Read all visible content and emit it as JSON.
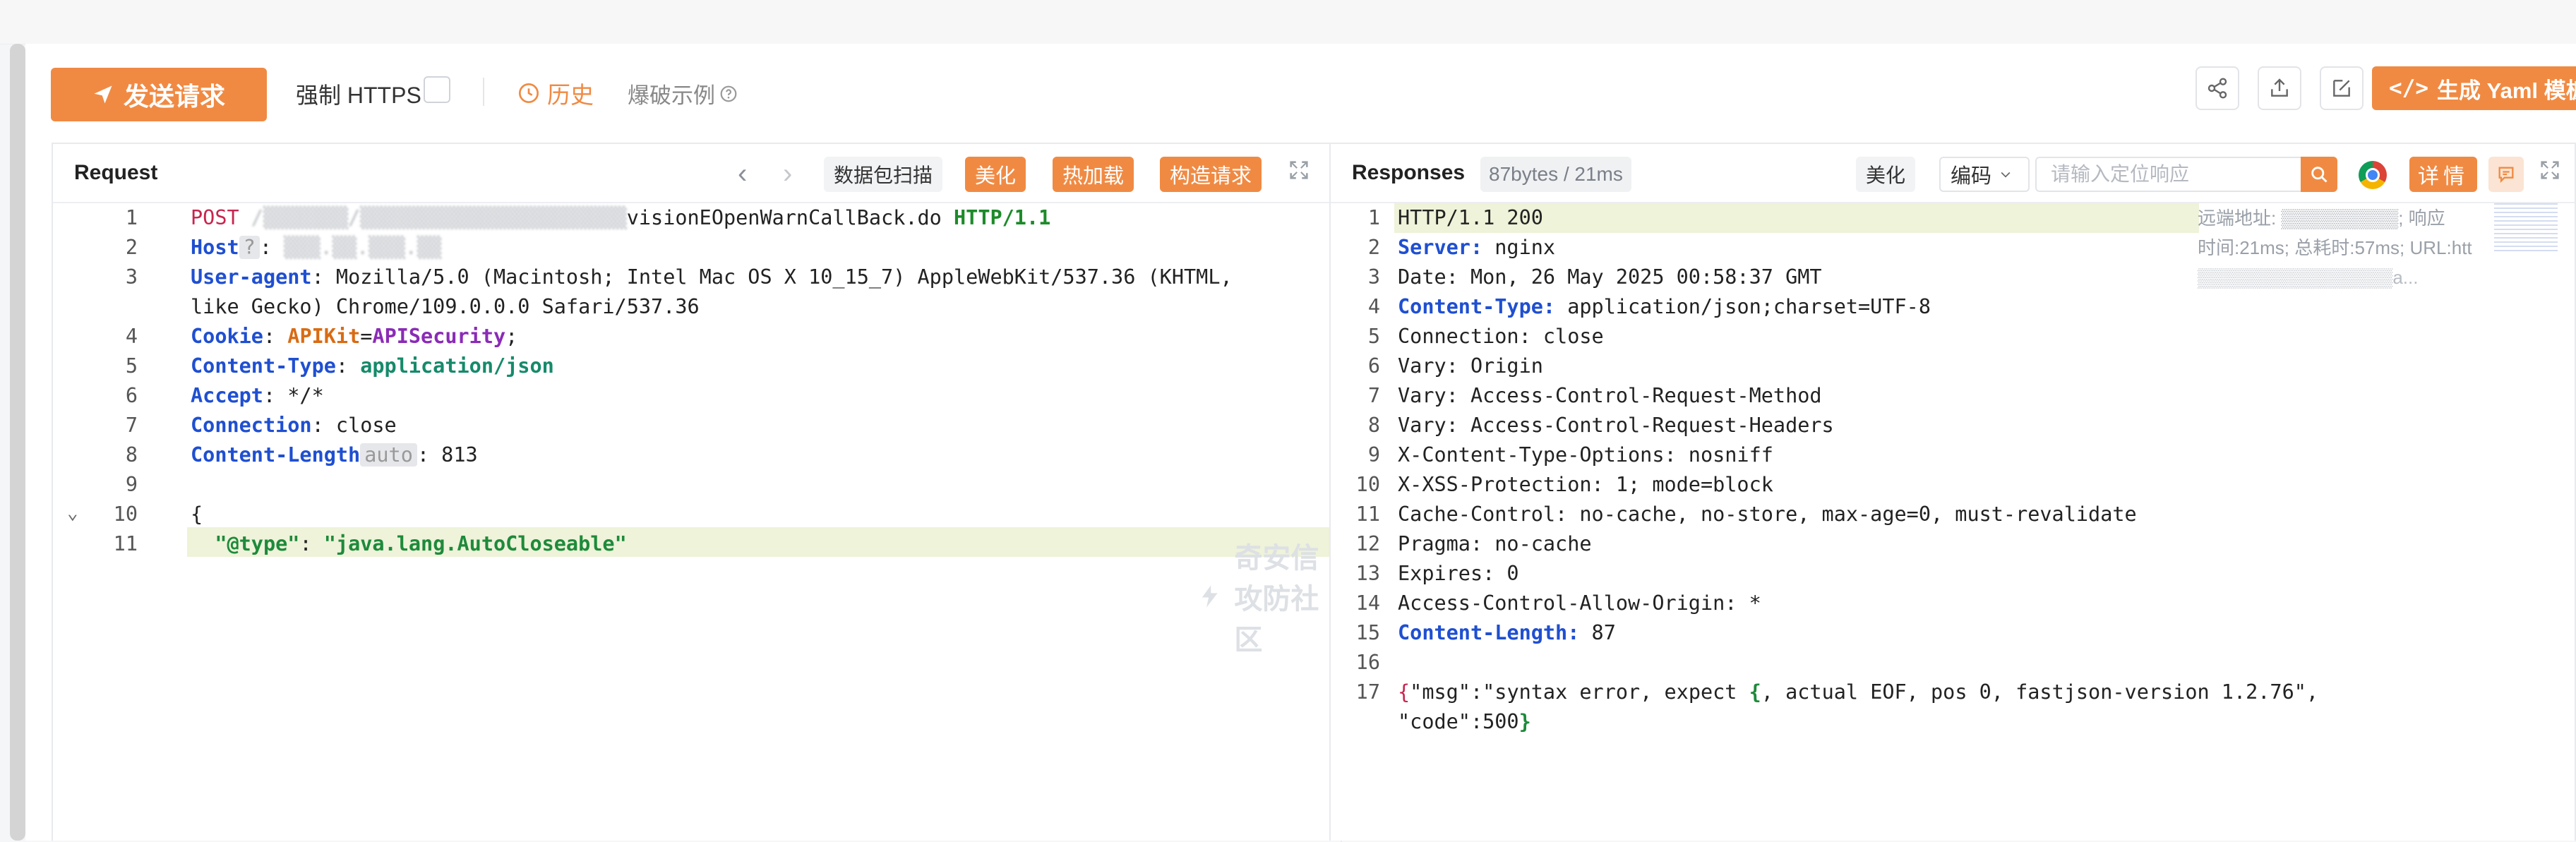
{
  "toolbar": {
    "send_label": "发送请求",
    "force_https_label": "强制 HTTPS",
    "history_label": "历史",
    "example_label": "爆破示例",
    "yaml_label": "生成 Yaml 模板"
  },
  "request": {
    "title": "Request",
    "scan_label": "数据包扫描",
    "beautify_label": "美化",
    "hotload_label": "热加载",
    "build_label": "构造请求"
  },
  "response": {
    "title": "Responses",
    "size_badge": "87bytes / 21ms",
    "beautify_label": "美化",
    "encode_label": "编码",
    "locate_placeholder": "请输入定位响应",
    "detail_label": "详情",
    "floating_info": [
      "远端地址: ▒▒▒▒▒▒▒▒▒; 响应",
      "时间:21ms; 总耗时:57ms; URL:htt",
      "▒▒▒▒▒▒▒▒▒▒▒▒▒▒▒a..."
    ]
  },
  "watermark": "奇安信攻防社区",
  "request_lines": [
    {
      "n": "1",
      "parts": [
        {
          "c": "k-red",
          "t": "POST "
        },
        {
          "c": "blur",
          "t": "/▒▒▒▒▒▒▒/▒▒▒▒▒▒▒▒▒▒▒▒▒▒▒▒▒▒▒▒▒▒"
        },
        {
          "c": "k-dark",
          "t": "visionEOpenWarnCallBack.do "
        },
        {
          "c": "k-green",
          "t": "HTTP/1.1"
        }
      ]
    },
    {
      "n": "2",
      "parts": [
        {
          "c": "k-blue",
          "t": "Host"
        },
        {
          "c": "chip",
          "t": "?"
        },
        {
          "c": "k-dark",
          "t": ": "
        },
        {
          "c": "blur",
          "t": "▒▒▒.▒▒.▒▒▒.▒▒"
        }
      ]
    },
    {
      "n": "3",
      "parts": [
        {
          "c": "k-blue",
          "t": "User-agent"
        },
        {
          "c": "k-dark",
          "t": ": Mozilla/5.0 (Macintosh; Intel Mac OS X 10_15_7) AppleWebKit/537.36 (KHTML,"
        }
      ]
    },
    {
      "n": "",
      "parts": [
        {
          "c": "k-dark",
          "t": "like Gecko) Chrome/109.0.0.0 Safari/537.36"
        }
      ]
    },
    {
      "n": "4",
      "parts": [
        {
          "c": "k-blue",
          "t": "Cookie"
        },
        {
          "c": "k-dark",
          "t": ": "
        },
        {
          "c": "k-orange",
          "t": "APIKit"
        },
        {
          "c": "k-dark",
          "t": "="
        },
        {
          "c": "k-purple",
          "t": "APISecurity"
        },
        {
          "c": "k-dark",
          "t": ";"
        }
      ]
    },
    {
      "n": "5",
      "parts": [
        {
          "c": "k-blue",
          "t": "Content-Type"
        },
        {
          "c": "k-dark",
          "t": ": "
        },
        {
          "c": "k-teal",
          "t": "application/json"
        }
      ]
    },
    {
      "n": "6",
      "parts": [
        {
          "c": "k-blue",
          "t": "Accept"
        },
        {
          "c": "k-dark",
          "t": ": */*"
        }
      ]
    },
    {
      "n": "7",
      "parts": [
        {
          "c": "k-blue",
          "t": "Connection"
        },
        {
          "c": "k-dark",
          "t": ": close"
        }
      ]
    },
    {
      "n": "8",
      "parts": [
        {
          "c": "k-blue",
          "t": "Content-Length"
        },
        {
          "c": "chip",
          "t": "auto"
        },
        {
          "c": "k-dark",
          "t": ": 813"
        }
      ]
    },
    {
      "n": "9",
      "parts": []
    },
    {
      "n": "10",
      "parts": [
        {
          "c": "k-dark",
          "t": "{"
        }
      ]
    },
    {
      "n": "11",
      "parts": [
        {
          "c": "k-dark",
          "t": "  "
        },
        {
          "c": "k-str",
          "t": "\"@type\""
        },
        {
          "c": "k-dark",
          "t": ": "
        },
        {
          "c": "k-str",
          "t": "\"java.lang.AutoCloseable\""
        }
      ]
    }
  ],
  "response_lines": [
    {
      "n": "1",
      "parts": [
        {
          "c": "k-dark",
          "t": "HTTP/1.1 200"
        }
      ]
    },
    {
      "n": "2",
      "parts": [
        {
          "c": "k-blue",
          "t": "Server:"
        },
        {
          "c": "k-dark",
          "t": " nginx"
        }
      ]
    },
    {
      "n": "3",
      "parts": [
        {
          "c": "k-dark",
          "t": "Date: Mon, 26 May 2025 00:58:37 GMT"
        }
      ]
    },
    {
      "n": "4",
      "parts": [
        {
          "c": "k-blue",
          "t": "Content-Type:"
        },
        {
          "c": "k-dark",
          "t": " application/json;charset=UTF-8"
        }
      ]
    },
    {
      "n": "5",
      "parts": [
        {
          "c": "k-dark",
          "t": "Connection: close"
        }
      ]
    },
    {
      "n": "6",
      "parts": [
        {
          "c": "k-dark",
          "t": "Vary: Origin"
        }
      ]
    },
    {
      "n": "7",
      "parts": [
        {
          "c": "k-dark",
          "t": "Vary: Access-Control-Request-Method"
        }
      ]
    },
    {
      "n": "8",
      "parts": [
        {
          "c": "k-dark",
          "t": "Vary: Access-Control-Request-Headers"
        }
      ]
    },
    {
      "n": "9",
      "parts": [
        {
          "c": "k-dark",
          "t": "X-Content-Type-Options: nosniff"
        }
      ]
    },
    {
      "n": "10",
      "parts": [
        {
          "c": "k-dark",
          "t": "X-XSS-Protection: 1; mode=block"
        }
      ]
    },
    {
      "n": "11",
      "parts": [
        {
          "c": "k-dark",
          "t": "Cache-Control: no-cache, no-store, max-age=0, must-revalidate"
        }
      ]
    },
    {
      "n": "12",
      "parts": [
        {
          "c": "k-dark",
          "t": "Pragma: no-cache"
        }
      ]
    },
    {
      "n": "13",
      "parts": [
        {
          "c": "k-dark",
          "t": "Expires: 0"
        }
      ]
    },
    {
      "n": "14",
      "parts": [
        {
          "c": "k-dark",
          "t": "Access-Control-Allow-Origin: *"
        }
      ]
    },
    {
      "n": "15",
      "parts": [
        {
          "c": "k-blue",
          "t": "Content-Length:"
        },
        {
          "c": "k-dark",
          "t": " 87"
        }
      ]
    },
    {
      "n": "16",
      "parts": []
    },
    {
      "n": "17",
      "parts": [
        {
          "c": "k-red",
          "t": "{"
        },
        {
          "c": "k-dark",
          "t": "\"msg\":\"syntax error, expect "
        },
        {
          "c": "k-str",
          "t": "{"
        },
        {
          "c": "k-dark",
          "t": ", actual EOF, pos 0, fastjson-version 1.2.76\","
        }
      ]
    },
    {
      "n": "",
      "parts": [
        {
          "c": "k-dark",
          "t": "\"code\":500"
        },
        {
          "c": "k-str",
          "t": "}"
        }
      ]
    }
  ],
  "colors": {
    "accent": "#f08a43",
    "highlight": "#eef3d9"
  }
}
